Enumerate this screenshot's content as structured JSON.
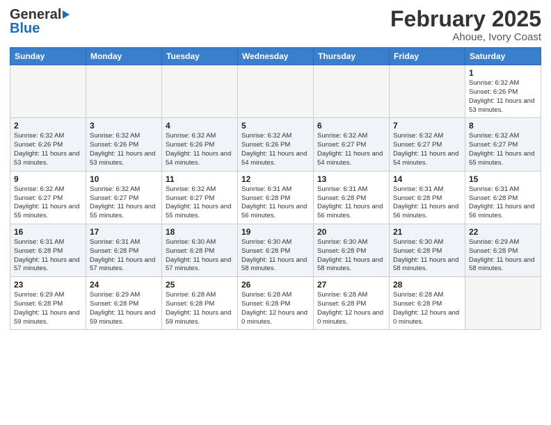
{
  "logo": {
    "general": "General",
    "blue": "Blue"
  },
  "header": {
    "title": "February 2025",
    "subtitle": "Ahoue, Ivory Coast"
  },
  "weekdays": [
    "Sunday",
    "Monday",
    "Tuesday",
    "Wednesday",
    "Thursday",
    "Friday",
    "Saturday"
  ],
  "weeks": [
    [
      {
        "day": "",
        "info": ""
      },
      {
        "day": "",
        "info": ""
      },
      {
        "day": "",
        "info": ""
      },
      {
        "day": "",
        "info": ""
      },
      {
        "day": "",
        "info": ""
      },
      {
        "day": "",
        "info": ""
      },
      {
        "day": "1",
        "info": "Sunrise: 6:32 AM\nSunset: 6:26 PM\nDaylight: 11 hours and 53 minutes."
      }
    ],
    [
      {
        "day": "2",
        "info": "Sunrise: 6:32 AM\nSunset: 6:26 PM\nDaylight: 11 hours and 53 minutes."
      },
      {
        "day": "3",
        "info": "Sunrise: 6:32 AM\nSunset: 6:26 PM\nDaylight: 11 hours and 53 minutes."
      },
      {
        "day": "4",
        "info": "Sunrise: 6:32 AM\nSunset: 6:26 PM\nDaylight: 11 hours and 54 minutes."
      },
      {
        "day": "5",
        "info": "Sunrise: 6:32 AM\nSunset: 6:26 PM\nDaylight: 11 hours and 54 minutes."
      },
      {
        "day": "6",
        "info": "Sunrise: 6:32 AM\nSunset: 6:27 PM\nDaylight: 11 hours and 54 minutes."
      },
      {
        "day": "7",
        "info": "Sunrise: 6:32 AM\nSunset: 6:27 PM\nDaylight: 11 hours and 54 minutes."
      },
      {
        "day": "8",
        "info": "Sunrise: 6:32 AM\nSunset: 6:27 PM\nDaylight: 11 hours and 55 minutes."
      }
    ],
    [
      {
        "day": "9",
        "info": "Sunrise: 6:32 AM\nSunset: 6:27 PM\nDaylight: 11 hours and 55 minutes."
      },
      {
        "day": "10",
        "info": "Sunrise: 6:32 AM\nSunset: 6:27 PM\nDaylight: 11 hours and 55 minutes."
      },
      {
        "day": "11",
        "info": "Sunrise: 6:32 AM\nSunset: 6:27 PM\nDaylight: 11 hours and 55 minutes."
      },
      {
        "day": "12",
        "info": "Sunrise: 6:31 AM\nSunset: 6:28 PM\nDaylight: 11 hours and 56 minutes."
      },
      {
        "day": "13",
        "info": "Sunrise: 6:31 AM\nSunset: 6:28 PM\nDaylight: 11 hours and 56 minutes."
      },
      {
        "day": "14",
        "info": "Sunrise: 6:31 AM\nSunset: 6:28 PM\nDaylight: 11 hours and 56 minutes."
      },
      {
        "day": "15",
        "info": "Sunrise: 6:31 AM\nSunset: 6:28 PM\nDaylight: 11 hours and 56 minutes."
      }
    ],
    [
      {
        "day": "16",
        "info": "Sunrise: 6:31 AM\nSunset: 6:28 PM\nDaylight: 11 hours and 57 minutes."
      },
      {
        "day": "17",
        "info": "Sunrise: 6:31 AM\nSunset: 6:28 PM\nDaylight: 11 hours and 57 minutes."
      },
      {
        "day": "18",
        "info": "Sunrise: 6:30 AM\nSunset: 6:28 PM\nDaylight: 11 hours and 57 minutes."
      },
      {
        "day": "19",
        "info": "Sunrise: 6:30 AM\nSunset: 6:28 PM\nDaylight: 11 hours and 58 minutes."
      },
      {
        "day": "20",
        "info": "Sunrise: 6:30 AM\nSunset: 6:28 PM\nDaylight: 11 hours and 58 minutes."
      },
      {
        "day": "21",
        "info": "Sunrise: 6:30 AM\nSunset: 6:28 PM\nDaylight: 11 hours and 58 minutes."
      },
      {
        "day": "22",
        "info": "Sunrise: 6:29 AM\nSunset: 6:28 PM\nDaylight: 11 hours and 58 minutes."
      }
    ],
    [
      {
        "day": "23",
        "info": "Sunrise: 6:29 AM\nSunset: 6:28 PM\nDaylight: 11 hours and 59 minutes."
      },
      {
        "day": "24",
        "info": "Sunrise: 6:29 AM\nSunset: 6:28 PM\nDaylight: 11 hours and 59 minutes."
      },
      {
        "day": "25",
        "info": "Sunrise: 6:28 AM\nSunset: 6:28 PM\nDaylight: 11 hours and 59 minutes."
      },
      {
        "day": "26",
        "info": "Sunrise: 6:28 AM\nSunset: 6:28 PM\nDaylight: 12 hours and 0 minutes."
      },
      {
        "day": "27",
        "info": "Sunrise: 6:28 AM\nSunset: 6:28 PM\nDaylight: 12 hours and 0 minutes."
      },
      {
        "day": "28",
        "info": "Sunrise: 6:28 AM\nSunset: 6:28 PM\nDaylight: 12 hours and 0 minutes."
      },
      {
        "day": "",
        "info": ""
      }
    ]
  ]
}
